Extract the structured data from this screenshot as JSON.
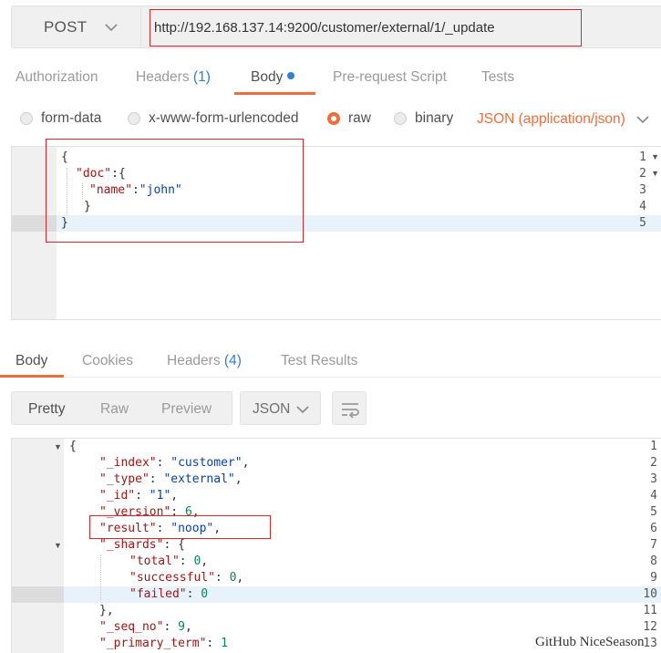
{
  "request": {
    "method": "POST",
    "url": "http://192.168.137.14:9200/customer/external/1/_update"
  },
  "request_tabs": {
    "authorization": "Authorization",
    "headers": "Headers",
    "headers_count": "(1)",
    "body": "Body",
    "prerequest": "Pre-request Script",
    "tests": "Tests"
  },
  "body_options": {
    "form_data": "form-data",
    "urlencoded": "x-www-form-urlencoded",
    "raw": "raw",
    "binary": "binary",
    "content_type": "JSON (application/json)",
    "selected": "raw"
  },
  "request_body": {
    "line_numbers": [
      "1",
      "2",
      "3",
      "4",
      "5"
    ],
    "line1": "{",
    "doc_key": "\"doc\"",
    "line2_tail": ":{",
    "name_key": "\"name\"",
    "colon": ":",
    "name_value": "\"john\"",
    "line4": "}",
    "line5": "}"
  },
  "response_tabs": {
    "body": "Body",
    "cookies": "Cookies",
    "headers": "Headers",
    "headers_count": "(4)",
    "test_results": "Test Results"
  },
  "response_toolbar": {
    "pretty": "Pretty",
    "raw": "Raw",
    "preview": "Preview",
    "format": "JSON"
  },
  "response_body": {
    "line_numbers": [
      "1",
      "2",
      "3",
      "4",
      "5",
      "6",
      "7",
      "8",
      "9",
      "10",
      "11",
      "12",
      "13"
    ],
    "open_brace": "{",
    "index_key": "\"_index\"",
    "index_value": "\"customer\"",
    "type_key": "\"_type\"",
    "type_value": "\"external\"",
    "id_key": "\"_id\"",
    "id_value": "\"1\"",
    "version_key": "\"_version\"",
    "version_value": "6",
    "result_key": "\"result\"",
    "result_value": "\"noop\"",
    "shards_key": "\"_shards\"",
    "total_key": "\"total\"",
    "total_value": "0",
    "successful_key": "\"successful\"",
    "successful_value": "0",
    "failed_key": "\"failed\"",
    "failed_value": "0",
    "close_shards": "},",
    "seq_no_key": "\"_seq_no\"",
    "seq_no_value": "9",
    "primary_term_key": "\"_primary_term\"",
    "primary_term_value": "1"
  },
  "watermark": "GitHub NiceSeason",
  "colors": {
    "accent": "#f26b3a",
    "link": "#2f7ed8",
    "highlight_box": "#d9262b"
  }
}
